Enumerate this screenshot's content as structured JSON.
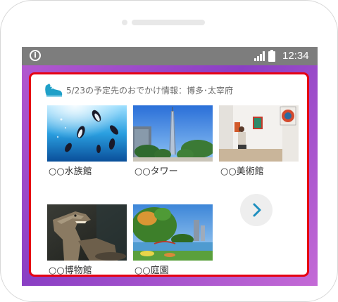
{
  "status_bar": {
    "time": "12:34",
    "icons": [
      "info-icon",
      "signal-icon",
      "battery-icon"
    ]
  },
  "header": {
    "title": "5/23の予定先のおでかけ情報：博多･太宰府",
    "icon": "sneaker-icon"
  },
  "spots": [
    {
      "label": "○○水族館",
      "image": "aquarium-penguins-photo"
    },
    {
      "label": "○○タワー",
      "image": "tower-photo"
    },
    {
      "label": "○○美術館",
      "image": "art-gallery-photo"
    },
    {
      "label": "○○博物館",
      "image": "dinosaur-museum-photo"
    },
    {
      "label": "○○庭園",
      "image": "japanese-garden-photo"
    }
  ],
  "next_button": {
    "icon": "chevron-right-icon"
  },
  "colors": {
    "card_border": "#e60012",
    "status_bar": "#7d7d7d",
    "accent_icon": "#1fa0c8",
    "chevron": "#1e8fbf"
  }
}
